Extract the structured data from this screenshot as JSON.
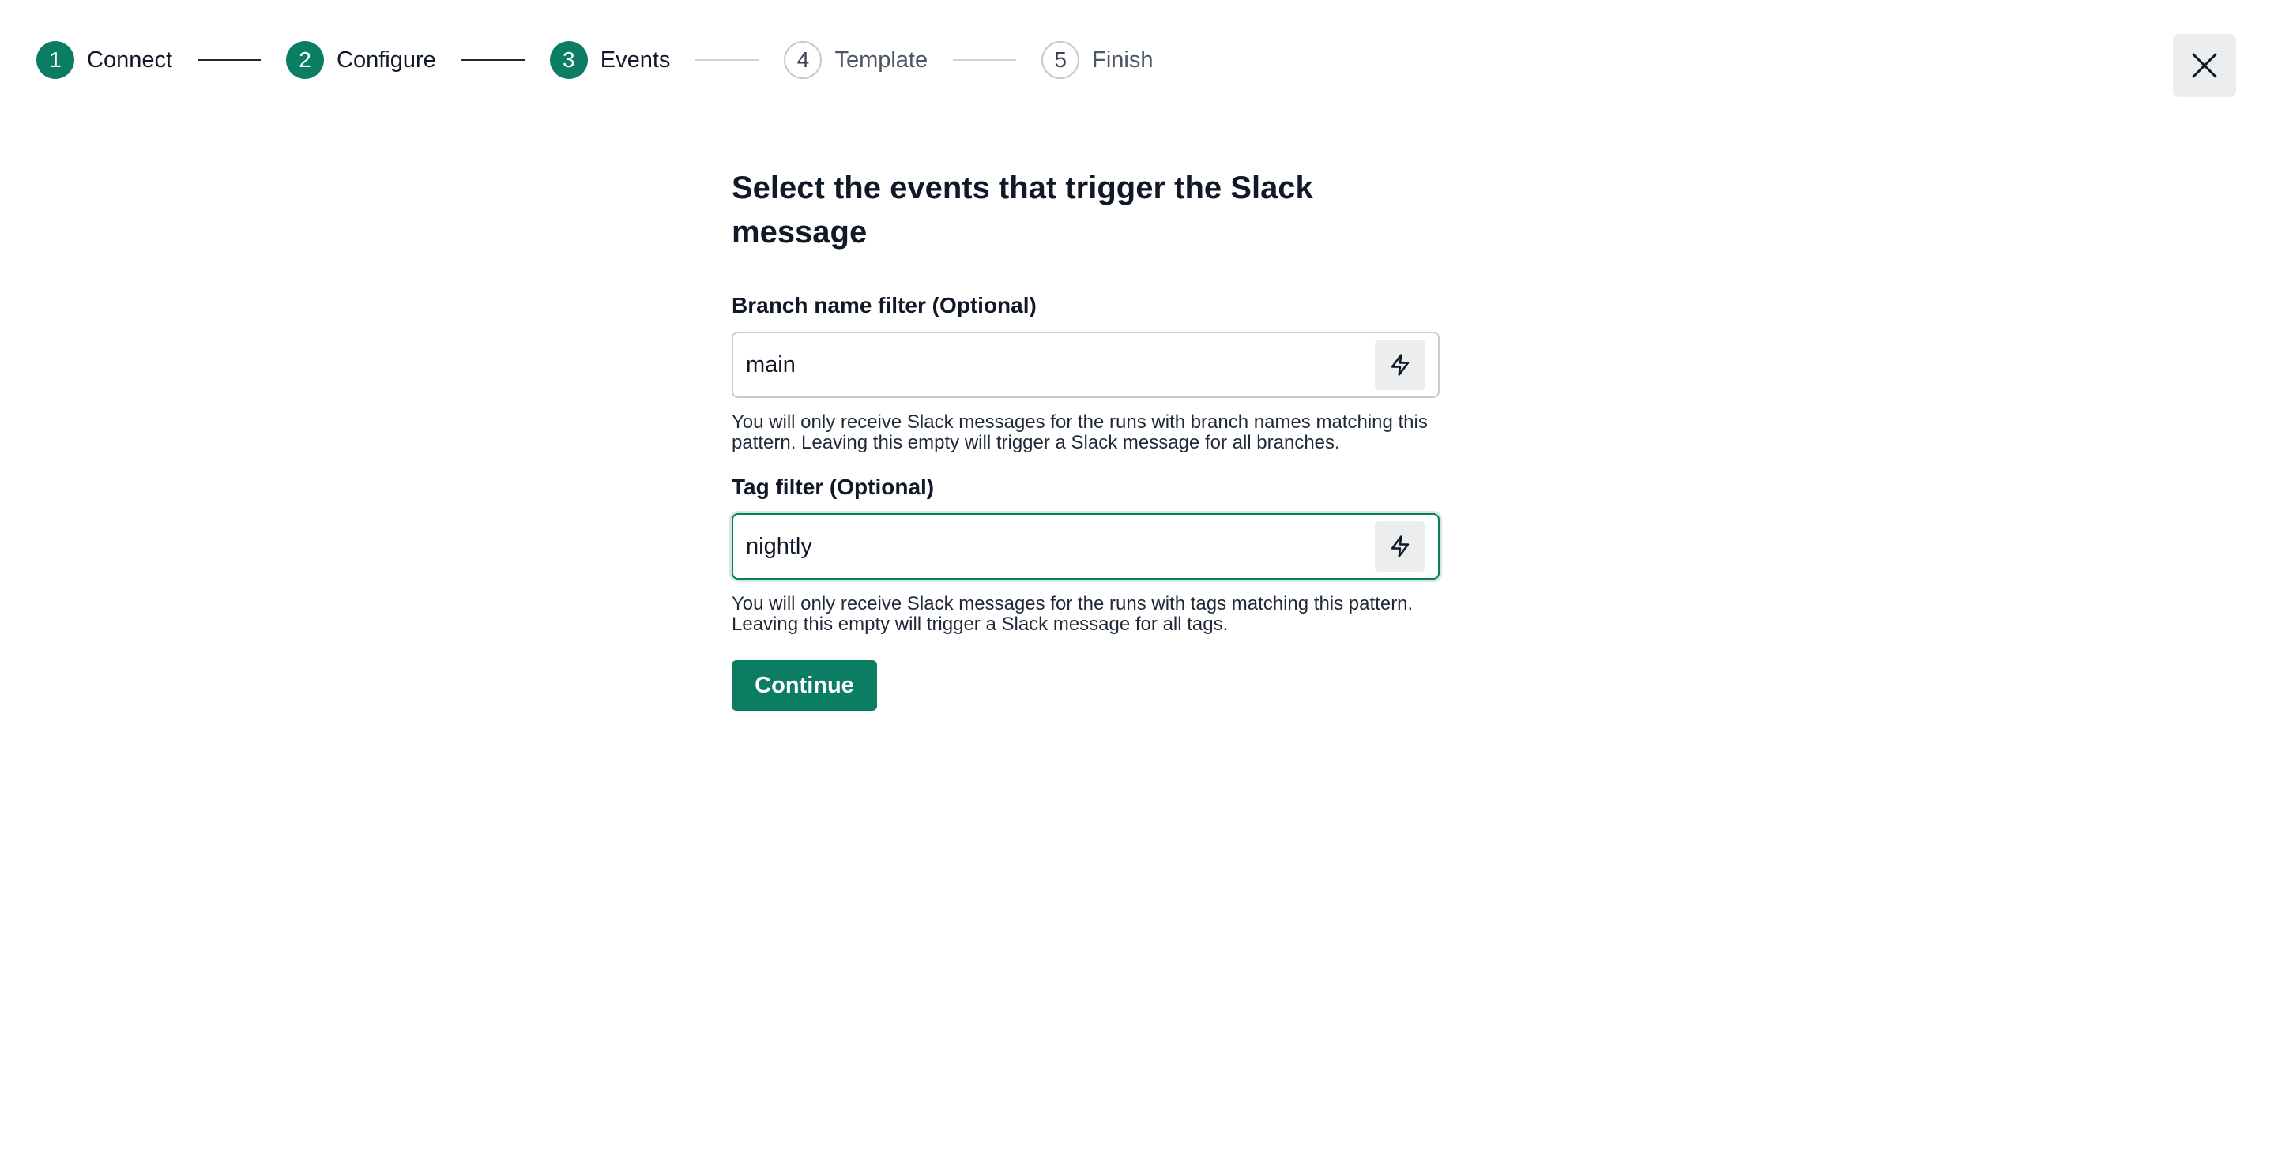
{
  "stepper": {
    "steps": [
      {
        "number": "1",
        "label": "Connect",
        "status": "complete"
      },
      {
        "number": "2",
        "label": "Configure",
        "status": "complete"
      },
      {
        "number": "3",
        "label": "Events",
        "status": "current"
      },
      {
        "number": "4",
        "label": "Template",
        "status": "upcoming"
      },
      {
        "number": "5",
        "label": "Finish",
        "status": "upcoming"
      }
    ]
  },
  "close_icon": "close-icon",
  "form": {
    "title": "Select the events that trigger the Slack message",
    "branch_filter": {
      "label": "Branch name filter (Optional)",
      "value": "main",
      "icon": "lightning-icon",
      "help": "You will only receive Slack messages for the runs with branch names matching this pattern. Leaving this empty will trigger a Slack message for all branches."
    },
    "tag_filter": {
      "label": "Tag filter (Optional)",
      "value": "nightly",
      "icon": "lightning-icon",
      "help": "You will only receive Slack messages for the runs with tags matching this pattern. Leaving this empty will trigger a Slack message for all tags."
    },
    "continue_label": "Continue"
  },
  "colors": {
    "accent": "#0a7d62",
    "icon_button_bg": "#ebedef",
    "border": "#c9cdd2"
  }
}
